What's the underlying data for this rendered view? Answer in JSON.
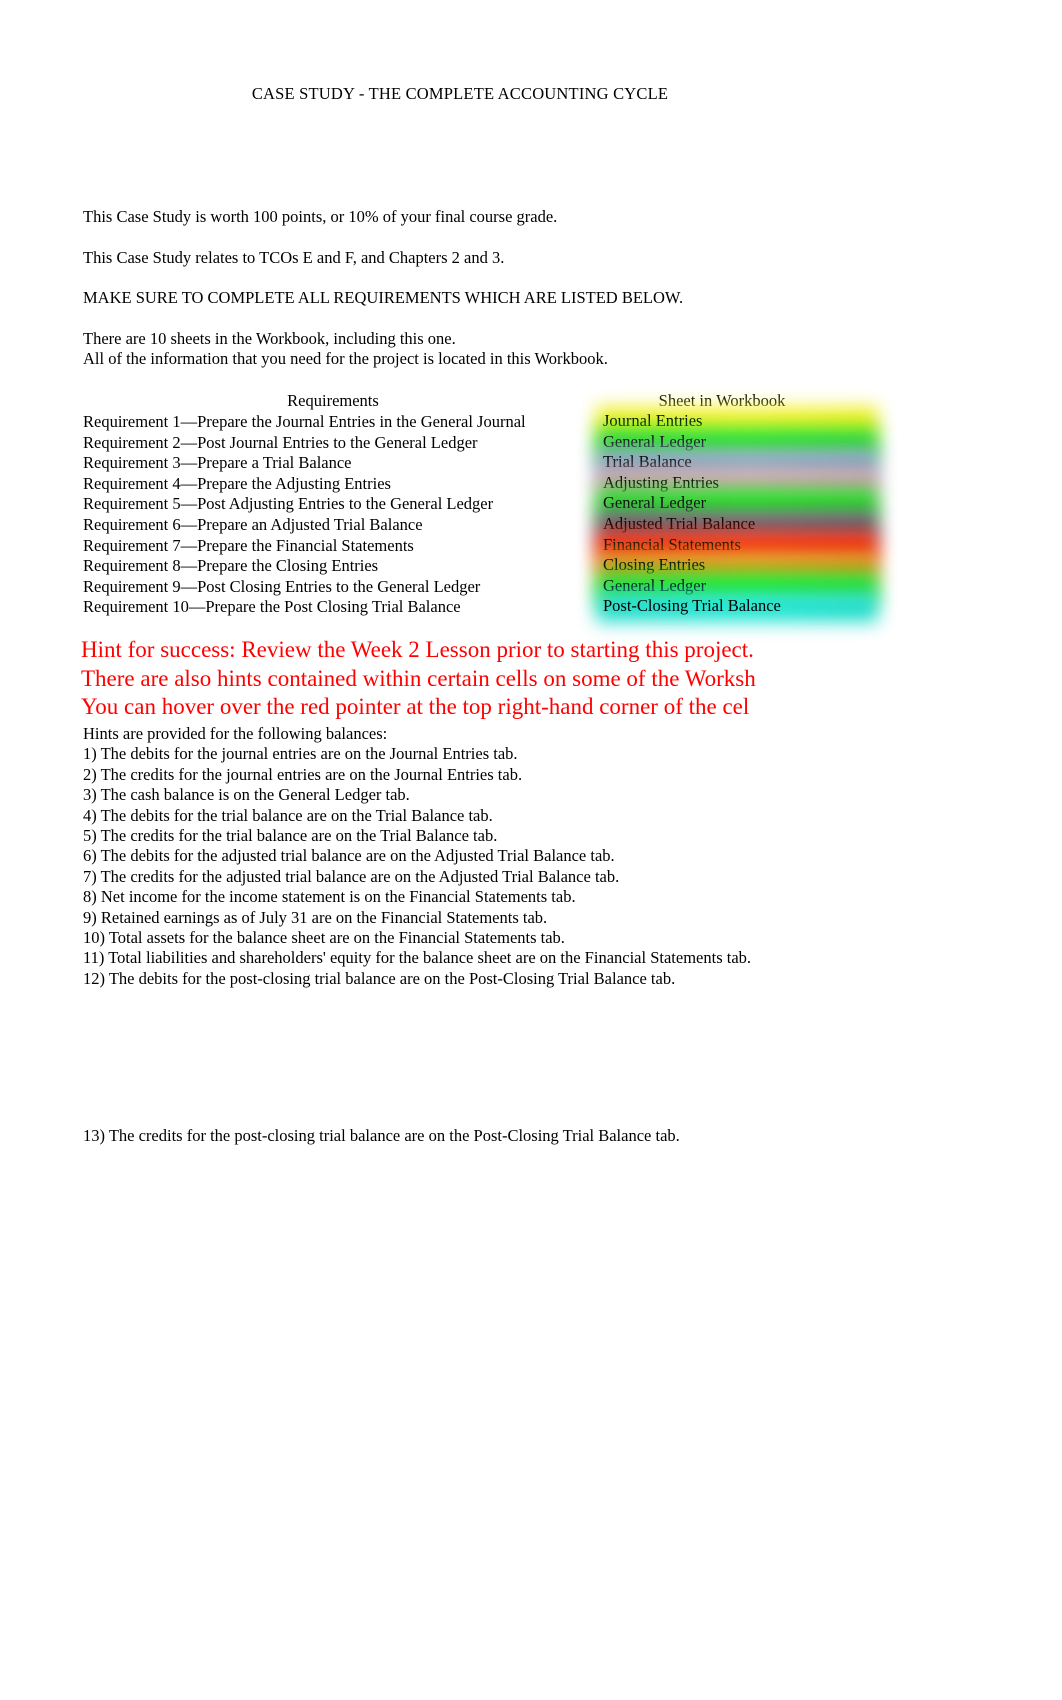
{
  "document": {
    "title": "CASE STUDY - THE COMPLETE ACCOUNTING CYCLE"
  },
  "intro": {
    "line1": "This Case Study is worth 100 points, or 10% of your final course grade.",
    "line2": "This Case Study relates to TCOs E and F, and Chapters 2 and 3.",
    "line3": "MAKE SURE TO COMPLETE ALL REQUIREMENTS WHICH ARE LISTED BELOW.",
    "line4": "There are 10 sheets in the Workbook, including this one.",
    "line5": "All of the information that you need for the project is located in this Workbook."
  },
  "requirements_table": {
    "header_requirements": "Requirements",
    "header_sheet": "Sheet in Workbook",
    "rows": [
      {
        "requirement": "Requirement 1—Prepare the Journal Entries in the General Journal",
        "sheet": "Journal Entries",
        "color": "#ecee14",
        "color2": "#f5f12a"
      },
      {
        "requirement": "Requirement 2—Post Journal Entries to the General Ledger",
        "sheet": "General Ledger",
        "color": "#1ddb1d",
        "color2": "#17e617"
      },
      {
        "requirement": "Requirement 3—Prepare a Trial Balance",
        "sheet": "Trial Balance",
        "color": "#7f9fbf",
        "color2": "#8aa8c6"
      },
      {
        "requirement": "Requirement 4—Prepare the Adjusting Entries",
        "sheet": "Adjusting Entries",
        "color": "#c99aa4",
        "color2": "#d0a6ad"
      },
      {
        "requirement": "Requirement 5—Post Adjusting Entries to the General Ledger",
        "sheet": "General Ledger",
        "color": "#1ddb1d",
        "color2": "#17e617"
      },
      {
        "requirement": "Requirement 6—Prepare an Adjusted Trial Balance",
        "sheet": "Adjusted Trial Balance",
        "color": "#5b5c6b",
        "color2": "#6a6275"
      },
      {
        "requirement": "Requirement 7—Prepare the Financial Statements",
        "sheet": "Financial Statements",
        "color": "#ef1c08",
        "color2": "#f52408"
      },
      {
        "requirement": "Requirement 8—Prepare the Closing Entries",
        "sheet": "Closing Entries",
        "color": "#df8e12",
        "color2": "#e89b16"
      },
      {
        "requirement": "Requirement 9—Post Closing Entries to the General Ledger",
        "sheet": "General Ledger",
        "color": "#1ddb1d",
        "color2": "#17e617"
      },
      {
        "requirement": "Requirement 10—Prepare the Post Closing Trial Balance",
        "sheet": "Post-Closing Trial Balance",
        "color": "#1cdbcb",
        "color2": "#19e6d6"
      }
    ]
  },
  "red_hints": {
    "line1": "Hint for success: Review the Week 2 Lesson prior to starting this project.",
    "line2": "There are also hints contained within certain cells on some of the Worksh",
    "line3": "You can hover over the red pointer at the top right-hand corner of the cel",
    "color": "#ff0000"
  },
  "hints": {
    "intro": "Hints are provided for the following balances:",
    "items": [
      "1) The debits for the journal entries are on the Journal Entries tab.",
      "2) The credits for the journal entries are on the Journal Entries tab.",
      "3) The cash balance is on the General Ledger tab.",
      "4) The debits for the trial balance are on the Trial Balance tab.",
      "5) The credits for the trial balance are on the Trial Balance tab.",
      "6) The debits for the adjusted trial balance are on the Adjusted Trial Balance tab.",
      "7) The credits for the adjusted trial balance are on the Adjusted Trial Balance tab.",
      "8) Net income for the income statement is on the Financial Statements tab.",
      "9) Retained earnings as of July 31 are on the Financial Statements tab.",
      "10) Total assets for the balance sheet are on the Financial Statements tab.",
      "11) Total liabilities and shareholders' equity for the balance sheet are on the Financial Statements tab.",
      "12) The debits for the post-closing trial balance are on the Post-Closing Trial Balance tab."
    ],
    "trailing_item": "13) The credits for the post-closing trial balance are on the Post-Closing Trial Balance tab."
  }
}
